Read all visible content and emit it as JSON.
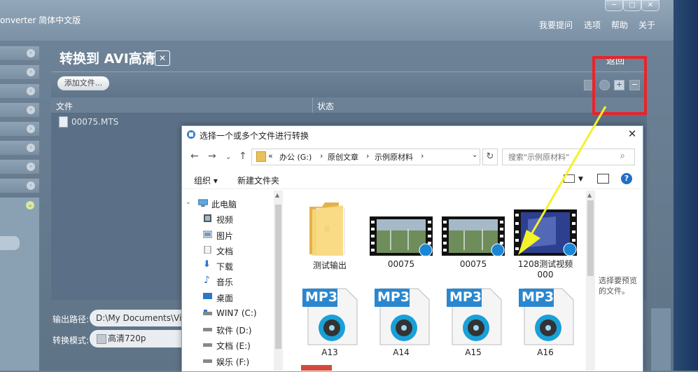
{
  "app": {
    "title": "onverter 简体中文版",
    "menu": [
      "我要提问",
      "选项",
      "帮助",
      "关于"
    ],
    "window_controls": [
      "─",
      "□",
      "✕"
    ]
  },
  "panel": {
    "title": "转换到 AVI高清",
    "back_label": "返回",
    "add_file_button": "添加文件...",
    "col_file": "文件",
    "col_status": "状态",
    "file_name": "00075.MTS"
  },
  "output": {
    "path_label": "输出路径:",
    "path_value": "D:\\My Documents\\Vid",
    "mode_label": "转换模式:",
    "mode_value": "高清720p"
  },
  "dialog": {
    "title": "选择一个或多个文件进行转换",
    "breadcrumb": [
      "«",
      "办公 (G:)",
      "›",
      "原创文章",
      "›",
      "示例原材料",
      "›"
    ],
    "search_placeholder": "搜索\"示例原材料\"",
    "organize": "组织 ▾",
    "new_folder": "新建文件夹",
    "tree": [
      "此电脑",
      "视频",
      "图片",
      "文档",
      "下载",
      "音乐",
      "桌面",
      "WIN7 (C:)",
      "软件 (D:)",
      "文档 (E:)",
      "娱乐 (F:)"
    ],
    "files": [
      {
        "name": "测试输出",
        "type": "folder"
      },
      {
        "name": "00075",
        "type": "video"
      },
      {
        "name": "00075",
        "type": "video"
      },
      {
        "name": "1208测试视频\n000",
        "type": "video"
      },
      {
        "name": "A13",
        "type": "mp3"
      },
      {
        "name": "A14",
        "type": "mp3"
      },
      {
        "name": "A15",
        "type": "mp3"
      },
      {
        "name": "A16",
        "type": "mp3"
      }
    ],
    "mp3_badge": "MP3",
    "preview_hint": "选择要预览的文件。"
  },
  "colors": {
    "highlight": "#e8242a",
    "arrow": "#f4f22a",
    "app_bg": "#6d8296"
  }
}
